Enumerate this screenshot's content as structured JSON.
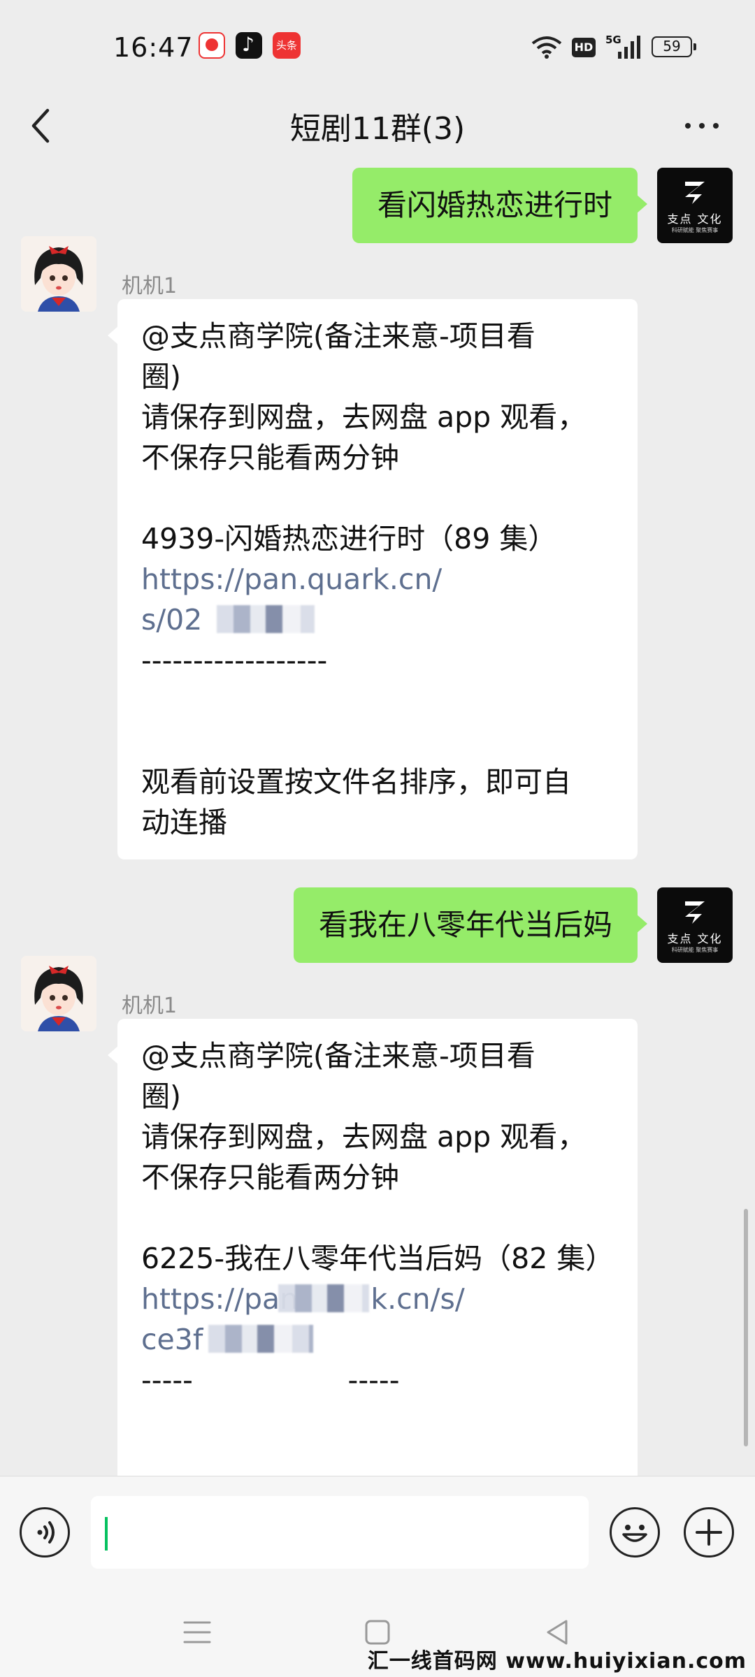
{
  "status_bar": {
    "time": "16:47",
    "apps": [
      "red-video-app-icon",
      "tiktok-app-icon",
      "toutiao-app-icon"
    ],
    "toutiao_label": "头条",
    "network_hd": "HD",
    "network_gen": "5G",
    "battery_level": "59"
  },
  "header": {
    "title": "短剧11群(3)"
  },
  "messages": [
    {
      "direction": "out",
      "text": "看闪婚热恋进行时",
      "avatar": {
        "name": "支点 文化",
        "tagline": "科研赋能 聚焦赛事"
      }
    },
    {
      "direction": "in",
      "sender": "机机1",
      "lines": [
        "@支点商学院(备注来意-项目看",
        "圈)",
        "请保存到网盘，去网盘 app 观看，",
        "不保存只能看两分钟",
        "",
        "4939-闪婚热恋进行时（89 集）",
        "https://pan.quark.cn/",
        "s/02",
        "------------------",
        "",
        "",
        "观看前设置按文件名排序，即可自",
        "动连播"
      ]
    },
    {
      "direction": "out",
      "text": "看我在八零年代当后妈",
      "avatar": {
        "name": "支点 文化",
        "tagline": "科研赋能 聚焦赛事"
      }
    },
    {
      "direction": "in",
      "sender": "机机1",
      "lines": [
        "@支点商学院(备注来意-项目看",
        "圈)",
        "请保存到网盘，去网盘 app 观看，",
        "不保存只能看两分钟",
        "",
        "6225-我在八零年代当后妈（82 集）",
        "https://pan        k.cn/s/",
        "ce3f",
        "-----                 -----"
      ]
    }
  ],
  "input_bar": {
    "text": ""
  },
  "watermark": {
    "text": "汇一线首码网",
    "url": "www.huiyixian.com"
  },
  "colors": {
    "outgoing_bubble": "#95ec69",
    "incoming_bubble": "#ffffff",
    "background": "#ededed",
    "link": "#5e6f8f",
    "caret": "#07c160"
  }
}
